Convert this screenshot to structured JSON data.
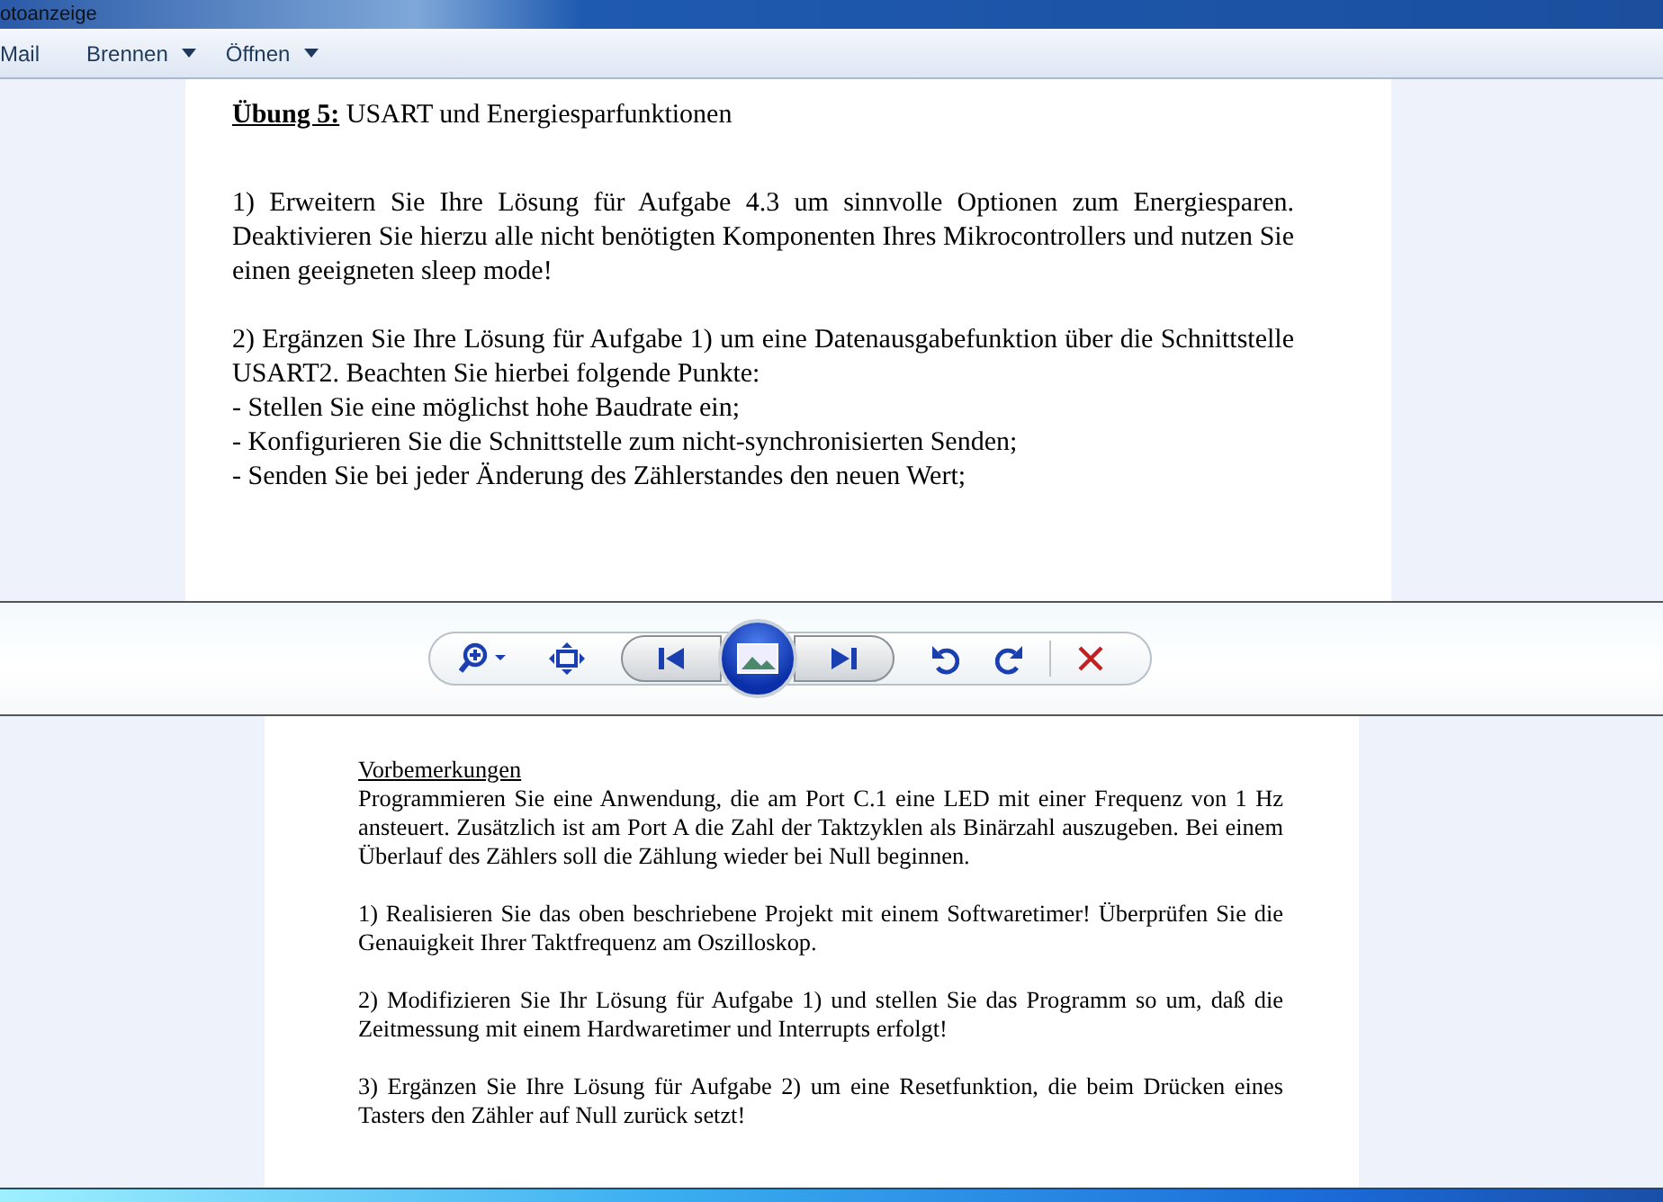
{
  "window": {
    "title": "otoanzeige"
  },
  "menu": [
    {
      "label": "Mail",
      "dropdown": false
    },
    {
      "label": "Brennen",
      "dropdown": true
    },
    {
      "label": "Öffnen",
      "dropdown": true
    }
  ],
  "page_1": {
    "heading_label": "Übung 5:",
    "heading_text": "USART und Energiesparfunktionen",
    "paragraphs": [
      "1) Erweitern Sie Ihre Lösung für Aufgabe 4.3 um sinnvolle Optionen zum Energiesparen. Deaktivieren Sie hierzu alle nicht benötigten Komponenten Ihres Mikrocontrollers und nutzen Sie einen geeigneten sleep mode!",
      "2) Ergänzen Sie Ihre Lösung für Aufgabe 1) um eine Datenausgabefunktion über die Schnittstelle USART2. Beachten Sie hierbei folgende Punkte:"
    ],
    "bullets": [
      "- Stellen Sie eine möglichst hohe Baudrate ein;",
      "- Konfigurieren Sie die Schnittstelle zum nicht-synchronisierten Senden;",
      "- Senden Sie bei jeder Änderung des Zählerstandes den neuen Wert;"
    ]
  },
  "page_2": {
    "subheading": "Vorbemerkungen",
    "paragraphs": [
      "Programmieren Sie eine Anwendung, die am Port C.1 eine LED mit einer Frequenz von 1 Hz ansteuert. Zusätzlich ist am Port A die Zahl der Taktzyklen als Binärzahl auszugeben. Bei einem Überlauf des Zählers soll die Zählung wieder bei Null beginnen.",
      "1) Realisieren Sie das oben beschriebene Projekt mit einem Softwaretimer! Überprüfen Sie die Genauigkeit Ihrer Taktfrequenz am Oszilloskop.",
      "2) Modifizieren Sie Ihr Lösung für Aufgabe 1) und stellen Sie das Programm so um, daß die Zeitmessung mit einem Hardwaretimer und Interrupts erfolgt!",
      "3) Ergänzen Sie Ihre Lösung für Aufgabe 2) um eine Resetfunktion, die beim Drücken eines Tasters den Zähler auf Null zurück setzt!"
    ]
  }
}
